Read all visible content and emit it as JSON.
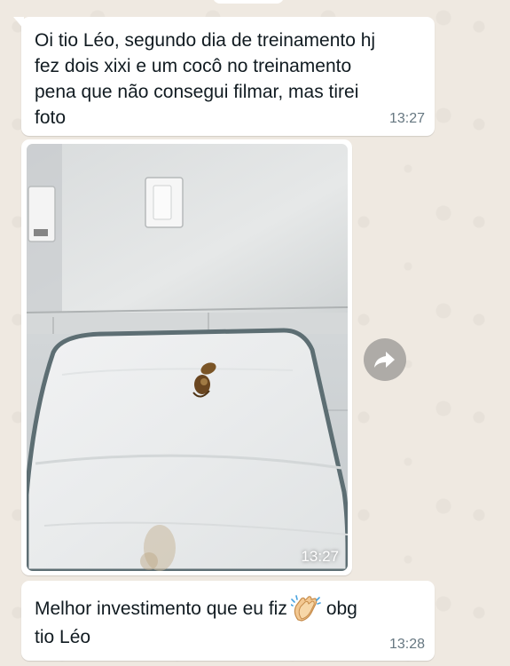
{
  "messages": [
    {
      "type": "text",
      "text": "Oi tio Léo, segundo dia de treinamento hj\nfez dois xixi e um cocô no treinamento\npena que não consegui filmar, mas tirei\nfoto",
      "time": "13:27"
    },
    {
      "type": "image",
      "time": "13:27",
      "image_description_icon": "photo-of-pee-pad"
    },
    {
      "type": "text",
      "text_before_emoji": "Melhor investimento que eu fiz",
      "emoji": "clapping-hands-icon",
      "text_after_emoji": "obg",
      "text_line2": "tio Léo",
      "time": "13:28"
    }
  ],
  "actions": {
    "forward_icon": "forward-arrow-icon"
  },
  "colors": {
    "chat_background": "#efe9e1",
    "bubble": "#ffffff",
    "text": "#111b21",
    "timestamp": "#667781",
    "forward_button": "#8c8c8c"
  }
}
